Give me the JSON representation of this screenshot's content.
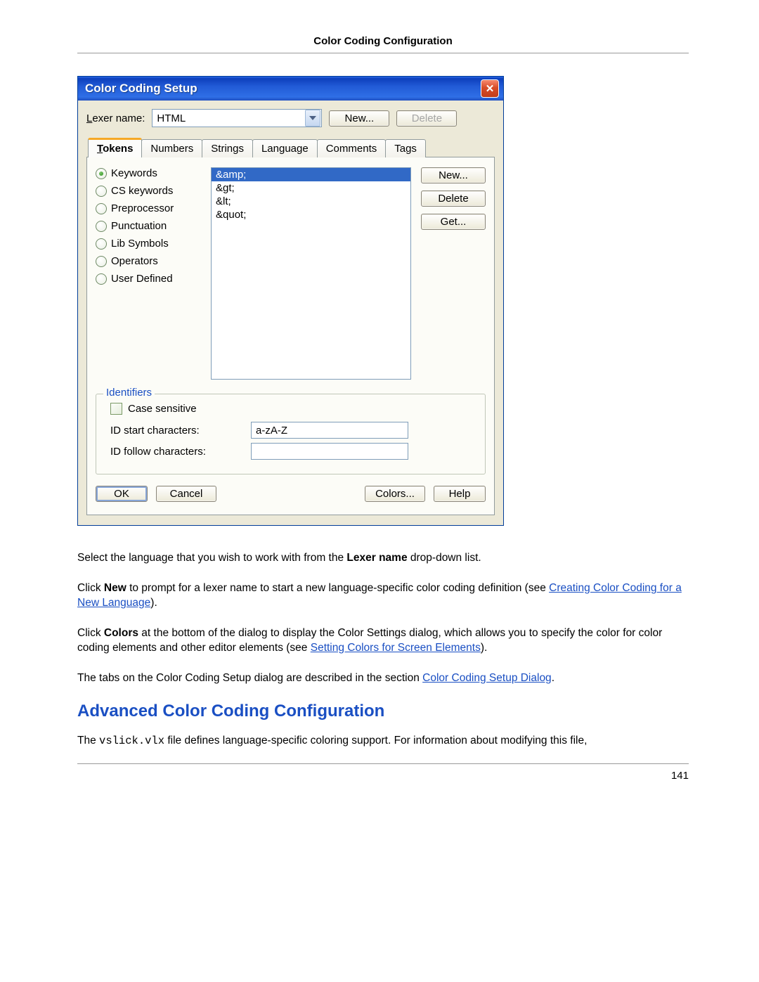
{
  "doc": {
    "header": "Color Coding Configuration",
    "page_number": "141"
  },
  "dialog": {
    "title": "Color Coding Setup",
    "lexer_label_pre": "L",
    "lexer_label_rest": "exer name:",
    "lexer_value": "HTML",
    "btn_new": "New...",
    "btn_delete": "Delete",
    "tabs": {
      "tokens_ul": "T",
      "tokens_rest": "okens",
      "numbers": "Numbers",
      "strings": "Strings",
      "language": "Language",
      "comments": "Comments",
      "tags": "Tags"
    },
    "radios": {
      "keywords": "Keywords",
      "cs_keywords": "CS keywords",
      "preprocessor": "Preprocessor",
      "punctuation": "Punctuation",
      "lib_symbols": "Lib Symbols",
      "operators": "Operators",
      "user_defined": "User Defined"
    },
    "tokens": {
      "0": "&amp;",
      "1": "&gt;",
      "2": "&lt;",
      "3": "&quot;"
    },
    "side_buttons": {
      "new": "New...",
      "delete": "Delete",
      "get": "Get..."
    },
    "identifiers": {
      "legend": "Identifiers",
      "case_sensitive": "Case sensitive",
      "id_start_label": "ID start characters:",
      "id_start_value": "a-zA-Z",
      "id_follow_label": "ID follow characters:",
      "id_follow_value": ""
    },
    "footer": {
      "ok": "OK",
      "cancel": "Cancel",
      "colors": "Colors...",
      "help": "Help"
    }
  },
  "body": {
    "p1_a": "Select the language that you wish to work with from the ",
    "p1_b": "Lexer name",
    "p1_c": " drop-down list.",
    "p2_a": "Click ",
    "p2_b": "New",
    "p2_c": " to prompt for a lexer name to start a new language-specific color coding definition (see ",
    "p2_link": "Creating Color Coding for a New Language",
    "p2_d": ").",
    "p3_a": "Click ",
    "p3_b": "Colors",
    "p3_c": " at the bottom of the dialog to display the Color Settings dialog, which allows you to specify the color for color coding elements and other editor elements (see ",
    "p3_link": "Setting Colors for Screen Elements",
    "p3_d": ").",
    "p4_a": "The tabs on the Color Coding Setup dialog are described in the section ",
    "p4_link": "Color Coding Setup Dialog",
    "p4_b": ".",
    "h2": "Advanced Color Coding Configuration",
    "p5_a": "The ",
    "p5_code": "vslick.vlx",
    "p5_b": " file defines language-specific coloring support. For information about modifying this file,"
  }
}
